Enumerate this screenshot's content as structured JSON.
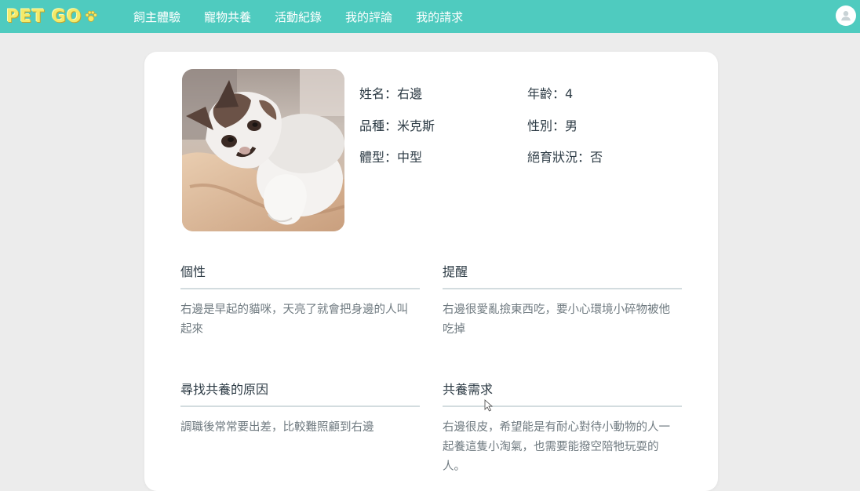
{
  "header": {
    "logo_text": "PET GO",
    "nav": [
      {
        "label": "飼主體驗"
      },
      {
        "label": "寵物共養"
      },
      {
        "label": "活動紀錄"
      },
      {
        "label": "我的評論"
      },
      {
        "label": "我的請求"
      }
    ],
    "user_icon": "user-avatar-icon"
  },
  "pet": {
    "photo_alt": "cat-photo",
    "fields": {
      "name": "姓名：右邊",
      "age": "年齡：4",
      "breed": "品種：米克斯",
      "gender": "性別：男",
      "size": "體型：中型",
      "neutered": "絕育狀況：否"
    }
  },
  "sections": {
    "personality": {
      "title": "個性",
      "body": "右邊是早起的貓咪，天亮了就會把身邊的人叫起來"
    },
    "reminder": {
      "title": "提醒",
      "body": "右邊很愛亂撿東西吃，要小心環境小碎物被他吃掉"
    },
    "reason": {
      "title": "尋找共養的原因",
      "body": "調職後常常要出差，比較難照顧到右邊"
    },
    "needs": {
      "title": "共養需求",
      "body": "右邊很皮，希望能是有耐心對待小動物的人一起養這隻小淘氣，也需要能撥空陪牠玩耍的人。"
    }
  },
  "colors": {
    "navbar": "#4fcbbf",
    "background": "#ececec",
    "card": "#ffffff",
    "divider": "#d3dcdf"
  }
}
